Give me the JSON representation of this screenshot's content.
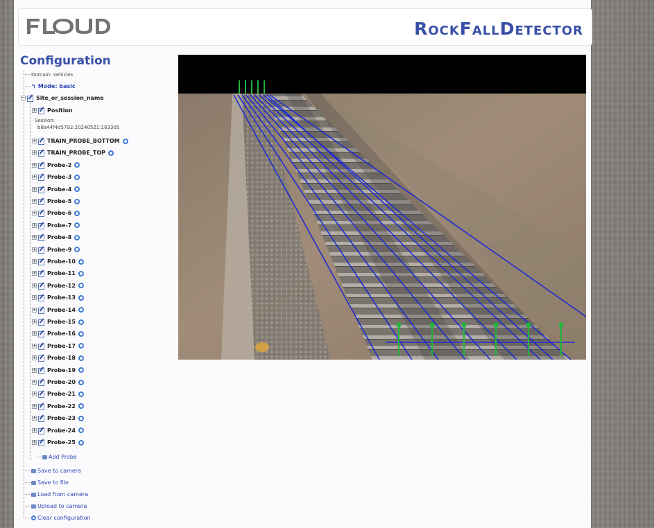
{
  "header": {
    "logo_text": "FLOUD",
    "app_title": "RockFallDetector"
  },
  "sidebar": {
    "title": "Configuration",
    "domain": "Domain: vehicles",
    "mode": "Mode: basic",
    "site": "Site_or_session_name",
    "position": "Position",
    "session_label": "Session:",
    "session_id": "b8a44f4d5792:20240521:163305",
    "probes": [
      "TRAIN_PROBE_BOTTOM",
      "TRAIN_PROBE_TOP",
      "Probe-2",
      "Probe-3",
      "Probe-4",
      "Probe-5",
      "Probe-6",
      "Probe-7",
      "Probe-8",
      "Probe-9",
      "Probe-10",
      "Probe-11",
      "Probe-12",
      "Probe-13",
      "Probe-14",
      "Probe-15",
      "Probe-16",
      "Probe-17",
      "Probe-18",
      "Probe-19",
      "Probe-20",
      "Probe-21",
      "Probe-22",
      "Probe-23",
      "Probe-24",
      "Probe-25"
    ],
    "add_probe": "Add Probe",
    "actions": [
      "Save to camera",
      "Save to file",
      "Load from camera",
      "Upload to camera",
      "Clear configuration"
    ]
  },
  "colors": {
    "brand_blue": "#3950a8",
    "probe_line_blue": "#2a2ec8",
    "marker_green": "#1fb43a"
  },
  "icons": {
    "edit": "edit-icon",
    "gear": "gear-icon",
    "expander": "expand-icon"
  }
}
